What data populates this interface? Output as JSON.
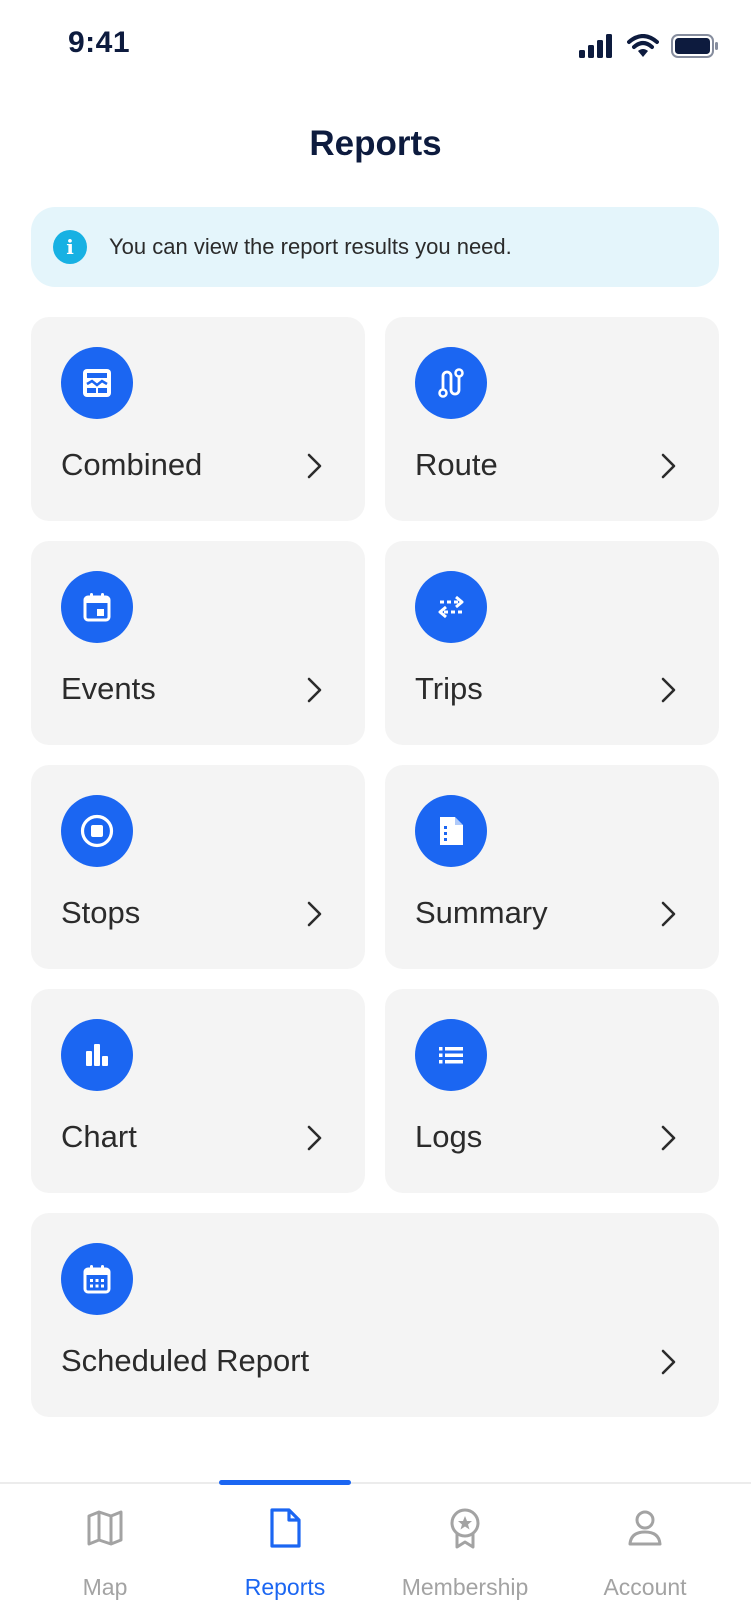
{
  "status_bar": {
    "time": "9:41"
  },
  "header": {
    "title": "Reports"
  },
  "info_banner": {
    "icon": "info-icon",
    "text": "You can view the report results you need."
  },
  "reports": [
    {
      "label": "Combined",
      "icon": "combined-report-icon"
    },
    {
      "label": "Route",
      "icon": "route-icon"
    },
    {
      "label": "Events",
      "icon": "calendar-event-icon"
    },
    {
      "label": "Trips",
      "icon": "trips-arrows-icon"
    },
    {
      "label": "Stops",
      "icon": "stop-icon"
    },
    {
      "label": "Summary",
      "icon": "summary-document-icon"
    },
    {
      "label": "Chart",
      "icon": "bar-chart-icon"
    },
    {
      "label": "Logs",
      "icon": "list-icon"
    },
    {
      "label": "Scheduled Report",
      "icon": "calendar-grid-icon"
    }
  ],
  "bottom_nav": {
    "active": "Reports",
    "items": [
      {
        "label": "Map",
        "icon": "map-icon"
      },
      {
        "label": "Reports",
        "icon": "document-icon"
      },
      {
        "label": "Membership",
        "icon": "medal-icon"
      },
      {
        "label": "Account",
        "icon": "person-icon"
      }
    ]
  },
  "colors": {
    "accent": "#1b66f2",
    "info": "#17b1e3",
    "info_bg": "#e4f5fb",
    "card_bg": "#f4f4f4",
    "title": "#0d1b3e",
    "inactive": "#a3a3a3"
  }
}
